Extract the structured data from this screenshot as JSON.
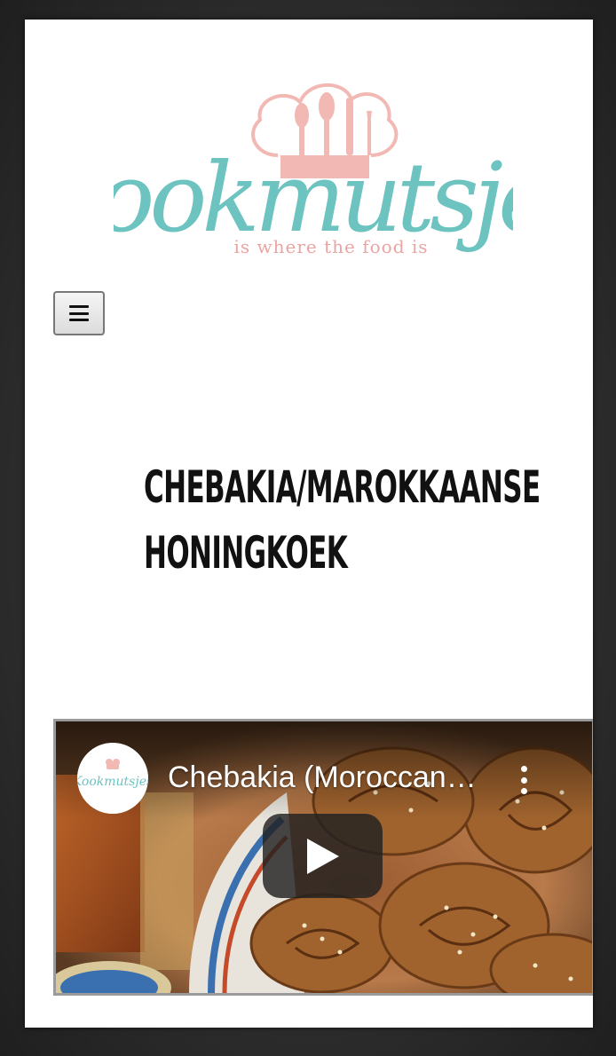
{
  "site": {
    "logo_wordmark": "Kookmutsjes",
    "logo_tagline": "is where the food is"
  },
  "nav": {
    "menu_icon": "hamburger-icon"
  },
  "article": {
    "title": "Chebakia/Marokkaanse Honingkoek"
  },
  "video": {
    "title": "Chebakia (Moroccan…",
    "channel_avatar_text": "Kookmutsjes",
    "play_icon": "play-icon",
    "more_icon": "more-vert-icon"
  },
  "colors": {
    "logo_teal": "#6cc3c0",
    "logo_pink": "#f2b8b3",
    "background": "#2e2e2e",
    "page": "#ffffff"
  }
}
